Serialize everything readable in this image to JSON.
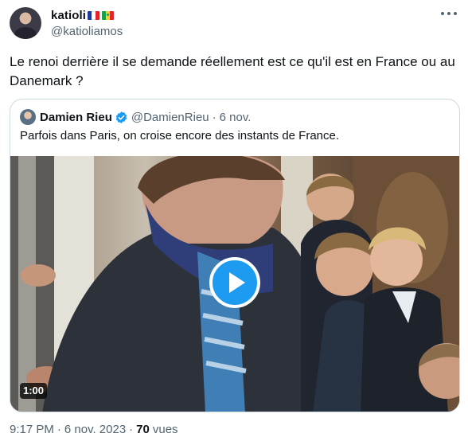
{
  "tweet": {
    "author": {
      "name": "katioli",
      "handle": "@katioliamos",
      "flag_icons": [
        "flag-france-icon",
        "flag-senegal-icon"
      ]
    },
    "text": "Le renoi derrière il se demande réellement est ce qu'il est en France ou au Danemark ?",
    "timestamp": "9:17 PM",
    "date": "6 nov. 2023",
    "views_count": "70",
    "views_label": "vues"
  },
  "quoted": {
    "name": "Damien Rieu",
    "verified": true,
    "handle": "@DamienRieu",
    "date": "6 nov.",
    "text": "Parfois dans Paris, on croise encore des instants de France.",
    "video": {
      "duration": "1:00",
      "icon": "play-icon"
    }
  },
  "colors": {
    "accent": "#1d9bf0",
    "secondary_text": "#536471",
    "border": "#cfd9de"
  }
}
